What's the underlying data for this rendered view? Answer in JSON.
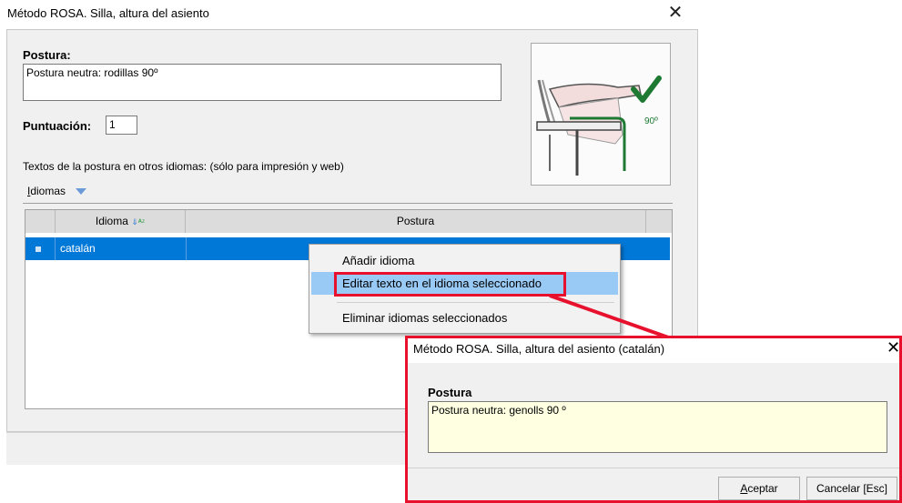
{
  "main": {
    "title": "Método ROSA. Silla, altura del asiento",
    "postura_label": "Postura:",
    "postura_value": "Postura neutra: rodillas 90º",
    "puntuacion_label": "Puntuación:",
    "puntuacion_value": "1",
    "otros_idiomas_text": "Textos de la postura en otros idiomas: (sólo para impresión y web)",
    "idiomas_menu_key": "I",
    "idiomas_menu_rest": "diomas",
    "image_badge": "90º"
  },
  "grid": {
    "columns": [
      "Idioma",
      "Postura"
    ],
    "rows": [
      {
        "idioma": "catalán",
        "postura": ""
      }
    ]
  },
  "context_menu": {
    "items": [
      "Añadir idioma",
      "Editar texto en el idioma seleccionado",
      "Eliminar idiomas seleccionados"
    ]
  },
  "dialog": {
    "title": "Método ROSA. Silla, altura del asiento (catalán)",
    "postura_label": "Postura",
    "postura_value": "Postura neutra: genolls 90 º",
    "accept_key": "A",
    "accept_rest": "ceptar",
    "cancel_label": "Cancelar [Esc]"
  },
  "colors": {
    "selection": "#0078d7",
    "menu_highlight": "#99c9f5",
    "annotation_red": "#e8112d",
    "check_green": "#1e7a33",
    "dialog_field": "#ffffe1"
  }
}
